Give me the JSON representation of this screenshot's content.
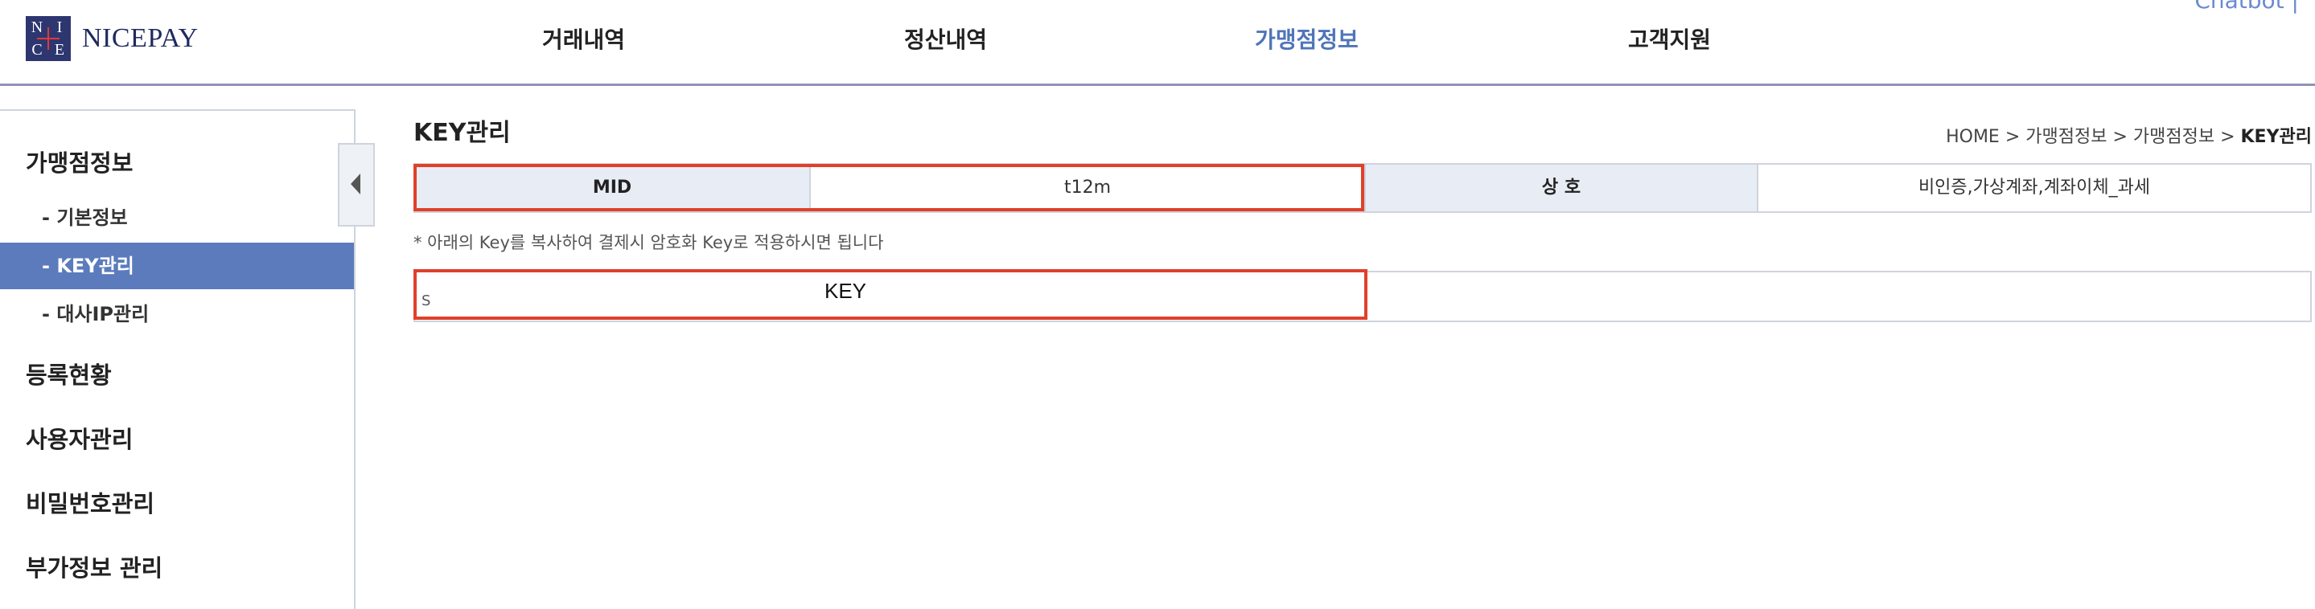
{
  "header": {
    "logo_letters": [
      "N",
      "I",
      "C",
      "E"
    ],
    "logo_text": "NICEPAY",
    "nav": [
      {
        "label": "거래내역"
      },
      {
        "label": "정산내역"
      },
      {
        "label": "가맹점정보",
        "active": true
      },
      {
        "label": "고객지원"
      }
    ],
    "util_text": "Chatbot  |  ",
    "accent_color": "#4f75b8"
  },
  "sidebar": {
    "sections": [
      {
        "label": "가맹점정보"
      },
      {
        "label": "등록현황"
      },
      {
        "label": "사용자관리"
      },
      {
        "label": "비밀번호관리"
      },
      {
        "label": "부가정보 관리"
      }
    ],
    "sub_items": [
      {
        "label": "- 기본정보"
      },
      {
        "label": "- KEY관리",
        "active": true
      },
      {
        "label": "- 대사IP관리"
      }
    ],
    "toggle_icon": "chevron-left-icon",
    "active_color": "#5b7bbd"
  },
  "main": {
    "title": "KEY관리",
    "breadcrumb": {
      "path": "HOME > 가맹점정보 > 가맹점정보 > ",
      "current": "KEY관리"
    },
    "info": {
      "mid_label": "MID",
      "mid_value": "t12m",
      "name_label": "상 호",
      "name_value": "비인증,가상계좌,계좌이체_과세"
    },
    "note": "* 아래의 Key를 복사하여 결제시 암호화 Key로 적용하시면 됩니다",
    "key": {
      "value": "KEY",
      "leading_char": "S"
    },
    "highlight_color": "#e0402b"
  }
}
